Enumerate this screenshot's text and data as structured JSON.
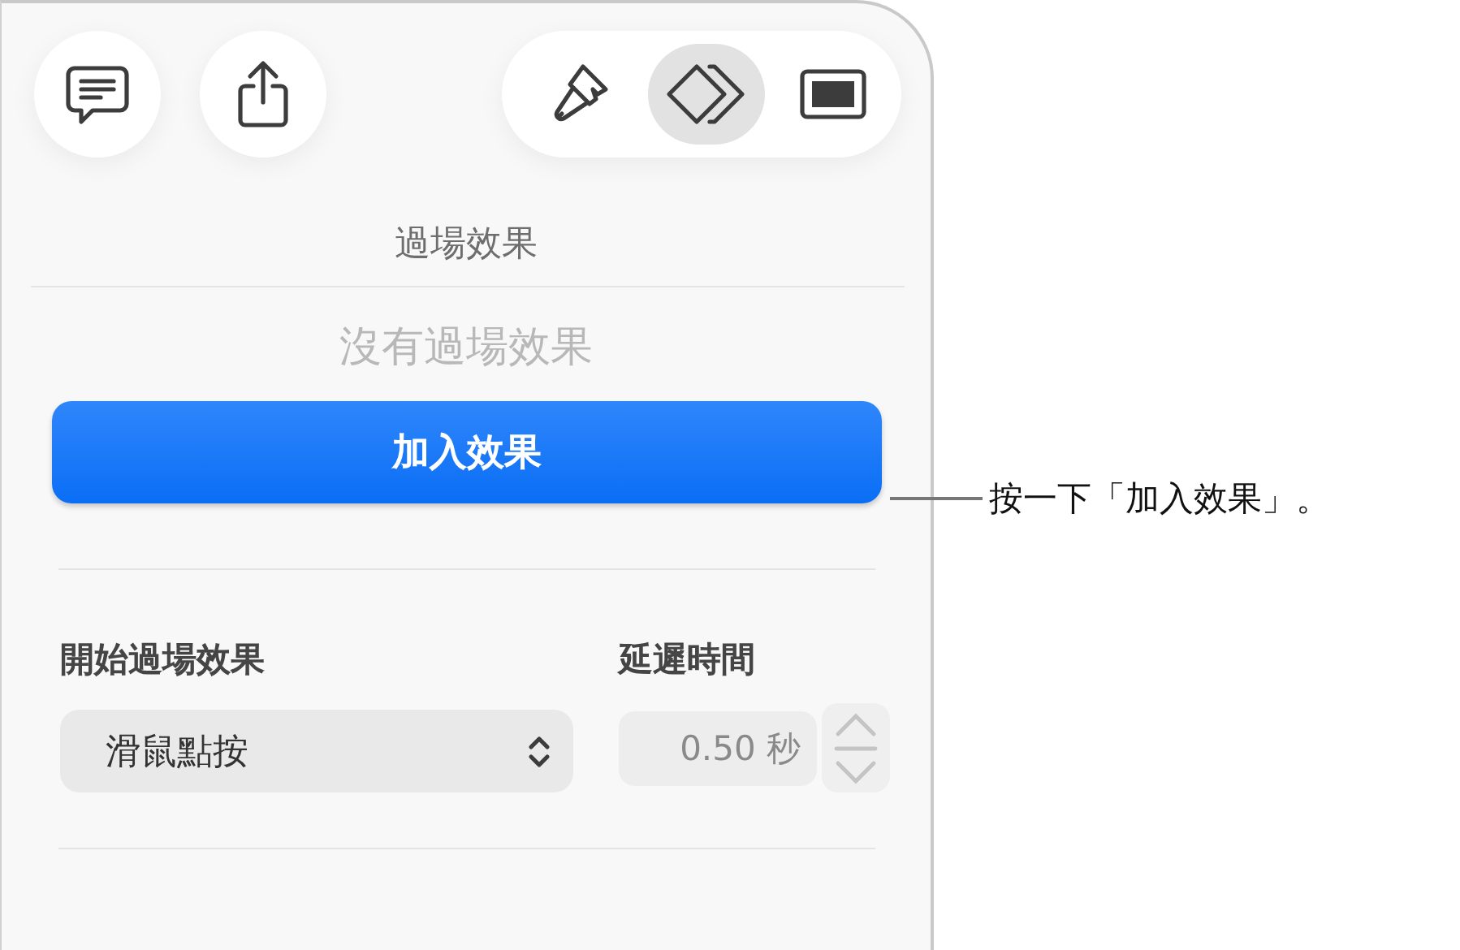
{
  "toolbar": {
    "left_buttons": [
      {
        "kind": "comment"
      },
      {
        "kind": "share"
      }
    ],
    "inspector_tabs": [
      {
        "kind": "format",
        "selected": false
      },
      {
        "kind": "animate",
        "selected": true
      },
      {
        "kind": "document",
        "selected": false
      }
    ]
  },
  "panel": {
    "title": "過場效果",
    "empty_message": "沒有過場效果",
    "add_button": "加入效果",
    "start_label": "開始過場效果",
    "start_value": "滑鼠點按",
    "delay_label": "延遲時間",
    "delay_value": "0.50 秒"
  },
  "callout": "按一下「加入效果」。"
}
